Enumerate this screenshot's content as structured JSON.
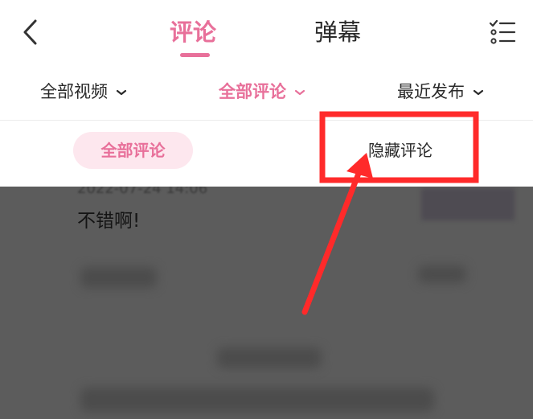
{
  "header": {
    "tabs": [
      {
        "label": "评论",
        "active": true
      },
      {
        "label": "弹幕",
        "active": false
      }
    ],
    "back_icon": "chevron-left-icon",
    "manage_icon": "checklist-icon"
  },
  "filters": [
    {
      "label": "全部视频",
      "active": false
    },
    {
      "label": "全部评论",
      "active": true
    },
    {
      "label": "最近发布",
      "active": false
    }
  ],
  "dropdown": {
    "options": [
      {
        "label": "全部评论",
        "selected": true
      },
      {
        "label": "隐藏评论",
        "selected": false
      }
    ]
  },
  "comment": {
    "date": "2022-07-24 14:06",
    "text": "不错啊!"
  },
  "colors": {
    "accent": "#e8709a",
    "chip_bg": "#fde7ee",
    "annotation": "#ff2a2a",
    "dim_overlay": "#5c5c5c"
  }
}
